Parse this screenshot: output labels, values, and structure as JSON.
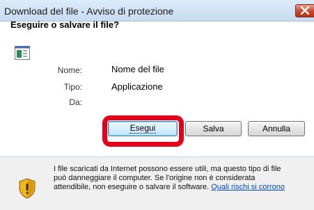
{
  "window": {
    "title": "Download del file - Avviso di protezione"
  },
  "dialog": {
    "heading": "Eseguire o salvare il file?",
    "fields": {
      "name_label": "Nome:",
      "name_value": "Nome del file",
      "type_label": "Tipo:",
      "type_value": "Applicazione",
      "from_label": "Da:",
      "from_value": ""
    },
    "buttons": {
      "run": "Esegui",
      "save": "Salva",
      "cancel": "Annulla"
    }
  },
  "warning": {
    "line1": "I file scaricati da Internet possono essere utili, ma questo tipo di file",
    "line2": "può danneggiare il computer. Se l'origine non è considerata",
    "line3_text": "attendibile, non eseguire o salvare il software. ",
    "link": "Quali rischi si corrono"
  },
  "colors": {
    "highlight_ring": "#e4001b",
    "link": "#0044cc",
    "close_button": "#c9452c"
  },
  "icons": {
    "file": "application-file-icon",
    "shield": "security-shield-icon",
    "close": "close-icon"
  }
}
